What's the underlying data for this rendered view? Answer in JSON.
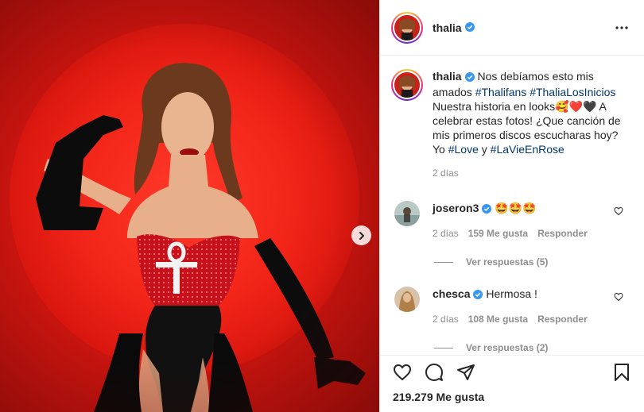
{
  "post": {
    "username": "thalia",
    "more_icon": "more-horizontal-icon",
    "next_icon": "chevron-right-icon"
  },
  "caption": {
    "username": "thalia",
    "text_1": "Nos debíamos esto mis amados ",
    "hashtag_1": "#Thalifans",
    "hashtag_2": "#ThaliaLosInicios",
    "text_2": "Nuestra historia en looks",
    "emojis": "🥰❤️🖤",
    "text_3": " A celebrar estas fotos! ¿Que canción de mis primeros discos escucharas hoy? Yo ",
    "hashtag_3": "#Love",
    "text_4": " y ",
    "hashtag_4": "#LaVieEnRose",
    "time": "2 días"
  },
  "comments": [
    {
      "username": "joseron3",
      "text": "🤩🤩🤩",
      "time": "2 días",
      "likes": "159 Me gusta",
      "reply": "Responder",
      "view_replies": "Ver respuestas (5)"
    },
    {
      "username": "chesca",
      "text": "Hermosa !",
      "time": "2 días",
      "likes": "108 Me gusta",
      "reply": "Responder",
      "view_replies": "Ver respuestas (2)"
    }
  ],
  "actions": {
    "like_icon": "heart-icon",
    "comment_icon": "comment-icon",
    "share_icon": "share-icon",
    "save_icon": "bookmark-icon"
  },
  "likes_count": "219.279 Me gusta",
  "colors": {
    "accent_link": "#00376b",
    "verified_blue": "#3897f0",
    "meta_gray": "#8e8e8e",
    "photo_red": "#e81e14"
  }
}
